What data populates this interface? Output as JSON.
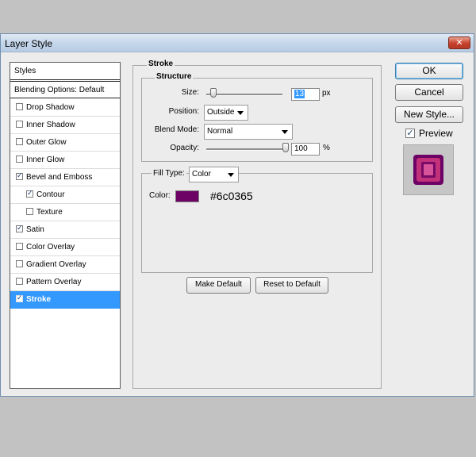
{
  "window": {
    "title": "Layer Style",
    "close_glyph": "✕"
  },
  "styles_list": {
    "header": "Styles",
    "blending": "Blending Options: Default",
    "items": [
      {
        "label": "Drop Shadow",
        "checked": false
      },
      {
        "label": "Inner Shadow",
        "checked": false
      },
      {
        "label": "Outer Glow",
        "checked": false
      },
      {
        "label": "Inner Glow",
        "checked": false
      },
      {
        "label": "Bevel and Emboss",
        "checked": true
      },
      {
        "label": "Contour",
        "checked": true
      },
      {
        "label": "Texture",
        "checked": false
      },
      {
        "label": "Satin",
        "checked": true
      },
      {
        "label": "Color Overlay",
        "checked": false
      },
      {
        "label": "Gradient Overlay",
        "checked": false
      },
      {
        "label": "Pattern Overlay",
        "checked": false
      },
      {
        "label": "Stroke",
        "checked": true,
        "selected": true
      }
    ]
  },
  "stroke": {
    "title": "Stroke",
    "structure_title": "Structure",
    "size_label": "Size:",
    "size_value": "13",
    "size_unit": "px",
    "size_fraction": 0.06,
    "position_label": "Position:",
    "position_value": "Outside",
    "blend_label": "Blend Mode:",
    "blend_value": "Normal",
    "opacity_label": "Opacity:",
    "opacity_value": "100",
    "opacity_unit": "%",
    "opacity_fraction": 1.0,
    "fill_type_label": "Fill Type:",
    "fill_type_value": "Color",
    "color_label": "Color:",
    "color_swatch": "#6c0365",
    "color_hex_text": "#6c0365",
    "make_default": "Make Default",
    "reset_default": "Reset to Default"
  },
  "buttons": {
    "ok": "OK",
    "cancel": "Cancel",
    "new_style": "New Style..."
  },
  "preview": {
    "label": "Preview",
    "checked": true,
    "glyph": "✓"
  },
  "colors": {
    "selection": "#3399ff",
    "stroke_color": "#6c0365",
    "preview_fill": "#c2327a"
  }
}
